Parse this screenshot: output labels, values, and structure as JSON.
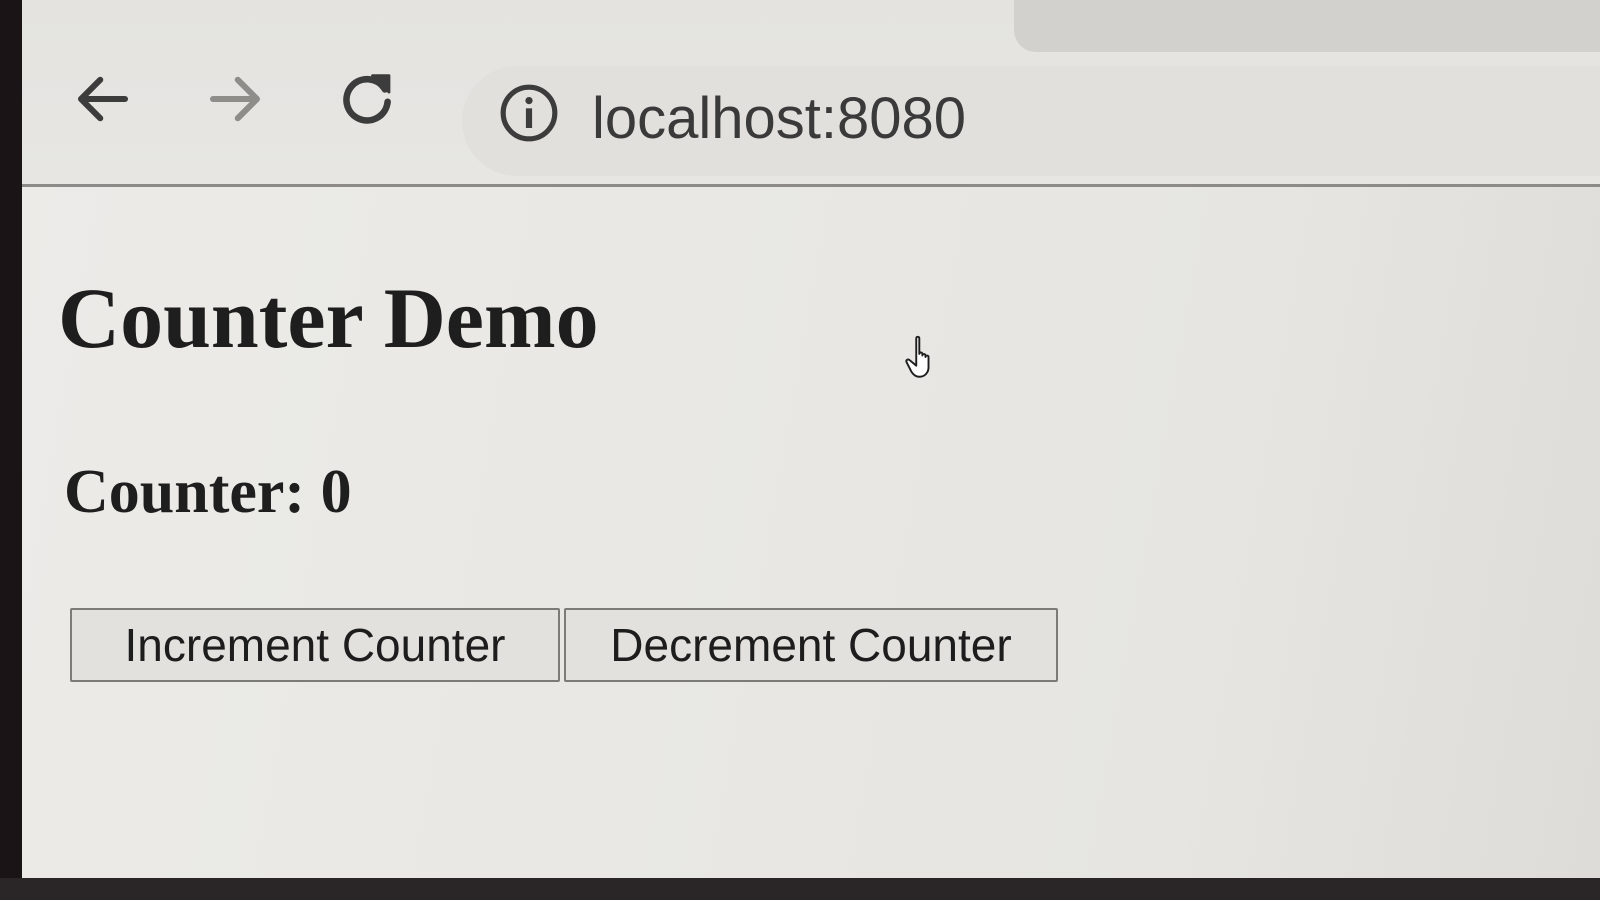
{
  "browser": {
    "url": "localhost:8080",
    "back_icon": "arrow-left-icon",
    "forward_icon": "arrow-right-icon",
    "reload_icon": "reload-icon",
    "site_info_icon": "info-icon"
  },
  "page": {
    "title": "Counter Demo",
    "counter_label": "Counter: 0",
    "buttons": {
      "increment": "Increment Counter",
      "decrement": "Decrement Counter"
    }
  },
  "cursor_icon": "hand-pointer-icon",
  "colors": {
    "text": "#1e1e1e",
    "page_background": "#e9e8e4",
    "button_background": "#e2e1de",
    "button_border": "#7c7b78"
  }
}
